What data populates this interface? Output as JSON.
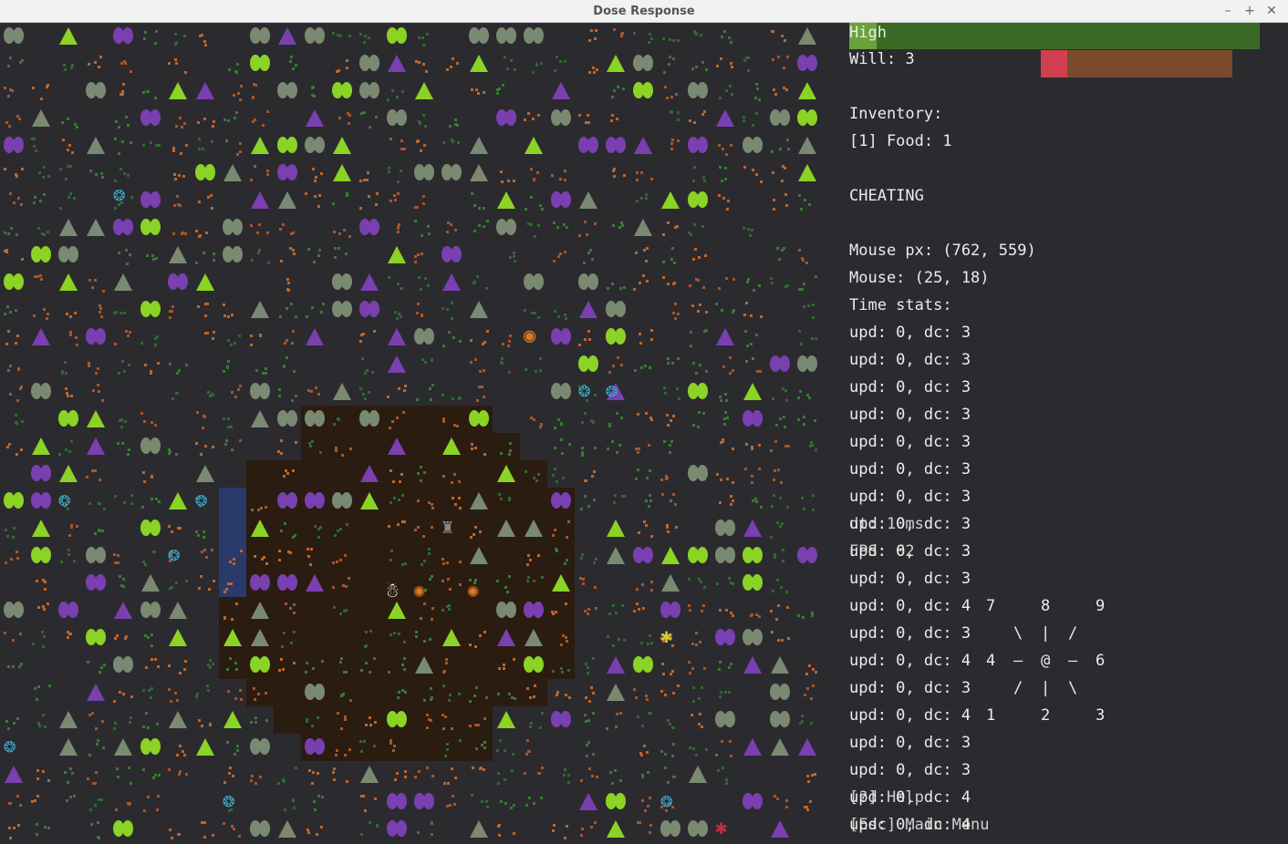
{
  "window": {
    "title": "Dose Response",
    "minimize": "–",
    "maximize": "+",
    "close": "✕"
  },
  "colors": {
    "floor": "#2b2b2f",
    "clearing": "#2a1c10",
    "water": "#2a3a6a",
    "tree_green": "#8bd325",
    "tree_grey": "#7a8a72",
    "tree_purple": "#7a3fb0",
    "player": "#ffffff",
    "dose": "#e07a20",
    "food": "#e07a20",
    "high_bar": "#3a6b25",
    "high_fill": "#6aa23a",
    "will_bar": "#7a4a2e",
    "will_fill": "#d04050"
  },
  "panel": {
    "high_label": "High",
    "high_level": 0.067,
    "will_label": "Will: 3",
    "will_level": 0.14,
    "inventory_header": "Inventory:",
    "inventory_items": [
      "[1] Food: 1"
    ],
    "cheating_label": "CHEATING",
    "mouse_px": "Mouse px: (762, 559)",
    "mouse_tile": "Mouse: (25, 18)",
    "time_stats_header": "Time stats:",
    "time_stats": [
      "upd: 0, dc: 3",
      "upd: 0, dc: 3",
      "upd: 0, dc: 3",
      "upd: 0, dc: 3",
      "upd: 0, dc: 3",
      "upd: 0, dc: 3",
      "upd: 0, dc: 3",
      "upd: 0, dc: 3",
      "upd: 0, dc: 3",
      "upd: 0, dc: 3",
      "upd: 0, dc: 4",
      "upd: 0, dc: 3",
      "upd: 0, dc: 4",
      "upd: 0, dc: 3",
      "upd: 0, dc: 4",
      "upd: 0, dc: 3",
      "upd: 0, dc: 3",
      "upd: 0, dc: 4",
      "upd: 0, dc: 4"
    ],
    "overlay_dt": "dt: 10ms",
    "overlay_fps": "FPS: 62",
    "help_label": "[?] Help",
    "menu_label": "[Esc] Main Menu",
    "numpad": [
      "7",
      "8",
      "9",
      "\\",
      "|",
      "/",
      "4",
      "–",
      "@",
      "–",
      "6",
      "/",
      "|",
      "\\",
      "1",
      "2",
      "3"
    ]
  },
  "map": {
    "entities": [
      {
        "type": "player",
        "icon": "player-icon"
      },
      {
        "type": "dose",
        "icon": "dose-icon"
      },
      {
        "type": "dose",
        "icon": "dose-icon"
      },
      {
        "type": "monster",
        "icon": "monster-icon"
      },
      {
        "type": "food",
        "icon": "food-icon"
      },
      {
        "type": "monster",
        "icon": "anxiety-monster-icon"
      },
      {
        "type": "monster",
        "icon": "spider-monster-icon"
      }
    ]
  }
}
